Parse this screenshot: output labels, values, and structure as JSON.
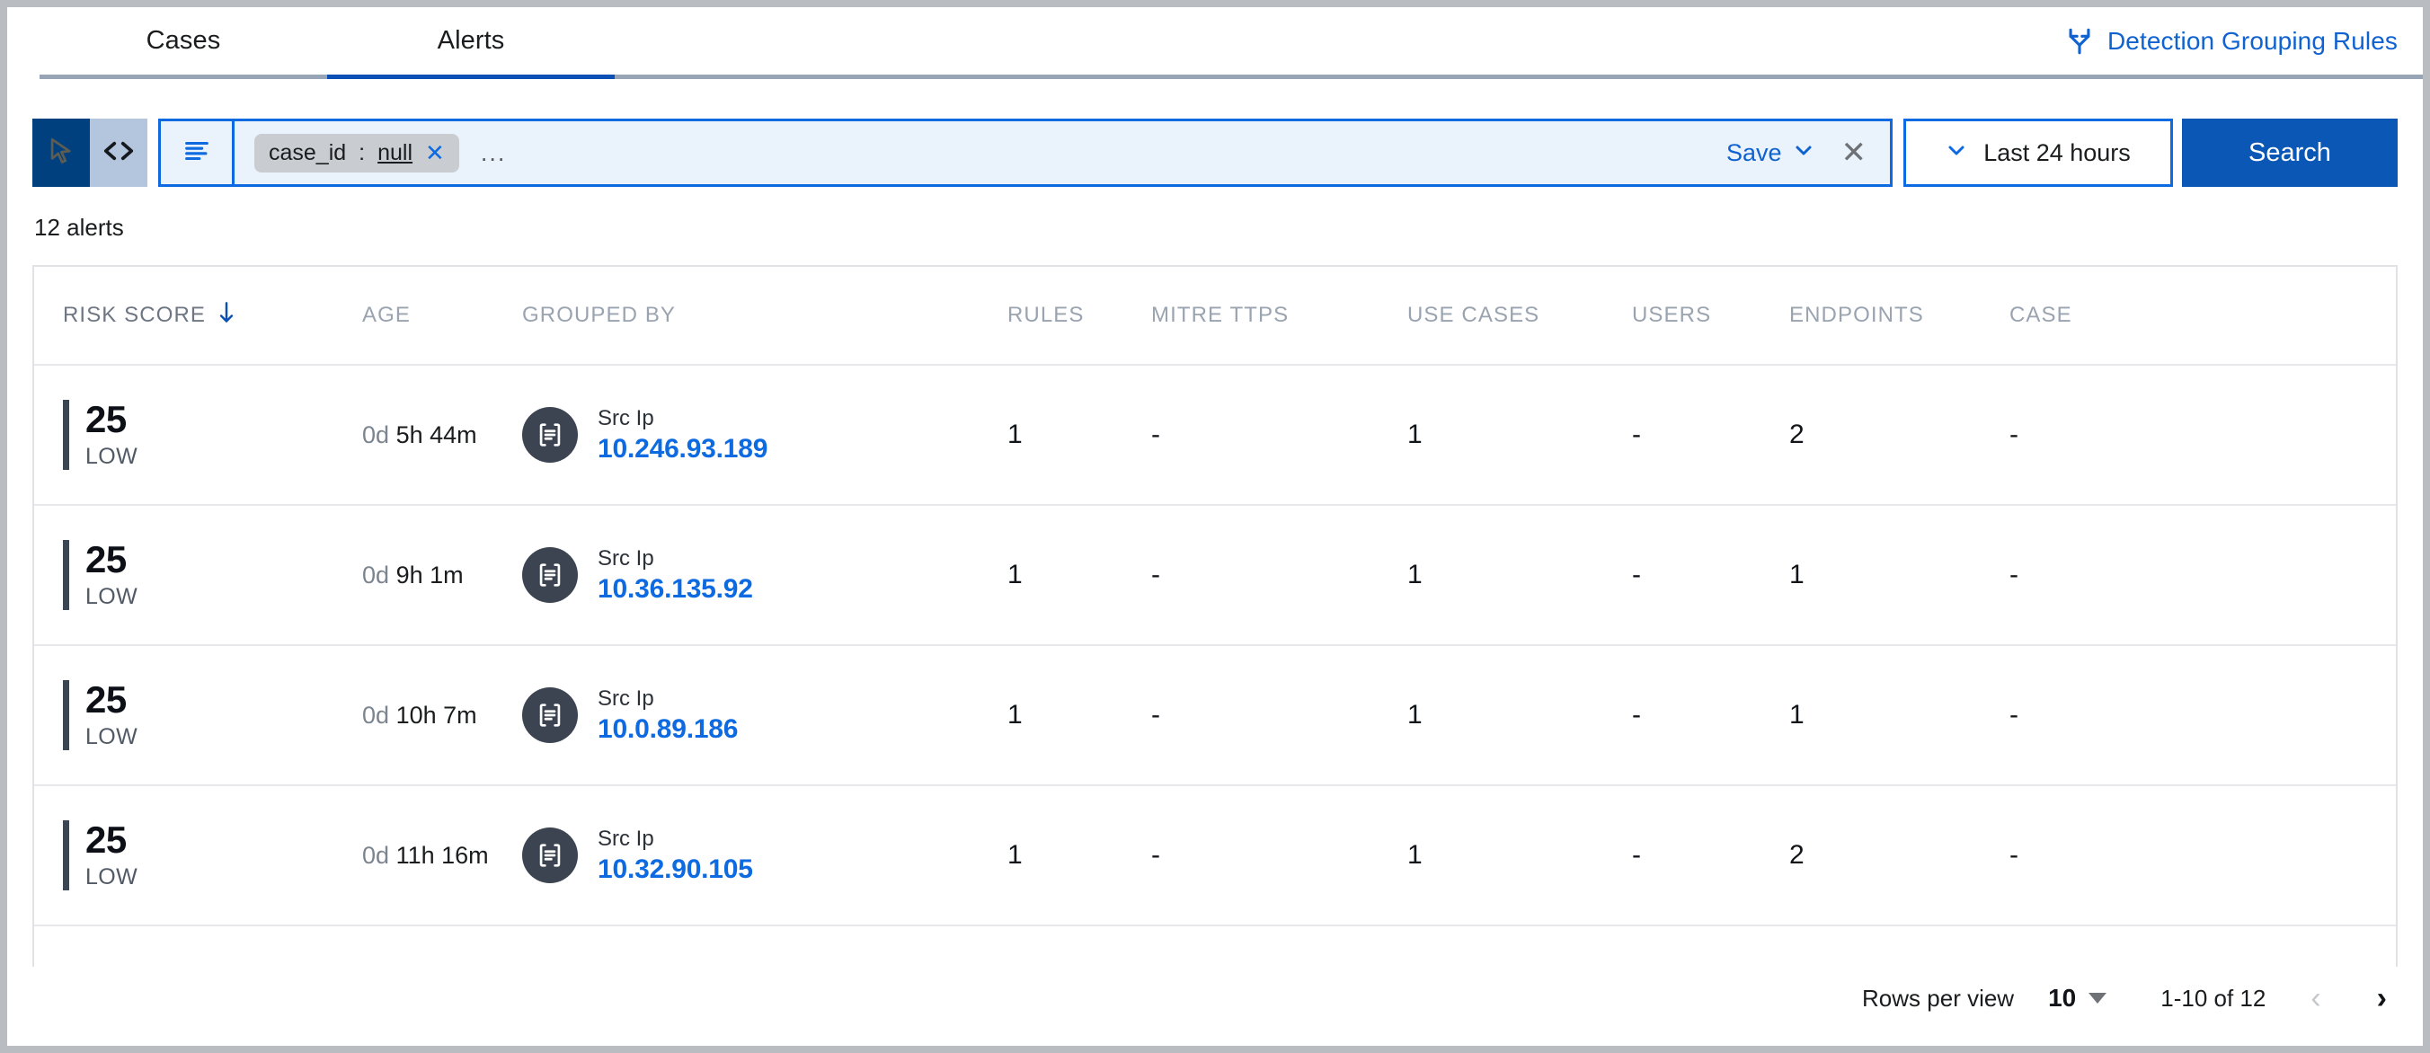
{
  "tabs": [
    {
      "label": "Cases",
      "active": false
    },
    {
      "label": "Alerts",
      "active": true
    }
  ],
  "header": {
    "detection_grouping_rules": "Detection Grouping Rules",
    "detection_grouping_rules_icon": "branch-fork-icon"
  },
  "search": {
    "mode_toggle": {
      "pointer_icon": "cursor-pointer-icon",
      "code_icon": "code-brackets-icon",
      "active": "pointer"
    },
    "filter_icon": "filter-list-icon",
    "filter_pill": {
      "field": "case_id",
      "separator": ":",
      "value": "null",
      "remove_icon": "close-x-icon"
    },
    "more_filters": "...",
    "save_label": "Save",
    "save_caret_icon": "chevron-down-icon",
    "clear_icon": "close-x-icon",
    "time_range": "Last 24 hours",
    "time_caret_icon": "chevron-down-icon",
    "search_button": "Search"
  },
  "results": {
    "count_label": "12 alerts",
    "columns": [
      {
        "key": "risk",
        "label": "RISK SCORE",
        "sorted": true,
        "sort_icon": "arrow-down-icon"
      },
      {
        "key": "age",
        "label": "AGE",
        "sorted": false
      },
      {
        "key": "group",
        "label": "GROUPED BY",
        "sorted": false
      },
      {
        "key": "rules",
        "label": "RULES",
        "sorted": false
      },
      {
        "key": "mitre",
        "label": "MITRE TTPS",
        "sorted": false
      },
      {
        "key": "usecase",
        "label": "USE CASES",
        "sorted": false
      },
      {
        "key": "users",
        "label": "USERS",
        "sorted": false
      },
      {
        "key": "end",
        "label": "ENDPOINTS",
        "sorted": false
      },
      {
        "key": "case",
        "label": "CASE",
        "sorted": false
      }
    ],
    "rows": [
      {
        "risk_score": "25",
        "risk_level": "LOW",
        "age_days": "0d",
        "age_time": "5h 44m",
        "group_icon": "field-value-icon",
        "group_field": "Src Ip",
        "group_value": "10.246.93.189",
        "rules": "1",
        "mitre_ttps": "-",
        "use_cases": "1",
        "users": "-",
        "endpoints": "2",
        "case": "-"
      },
      {
        "risk_score": "25",
        "risk_level": "LOW",
        "age_days": "0d",
        "age_time": "9h 1m",
        "group_icon": "field-value-icon",
        "group_field": "Src Ip",
        "group_value": "10.36.135.92",
        "rules": "1",
        "mitre_ttps": "-",
        "use_cases": "1",
        "users": "-",
        "endpoints": "1",
        "case": "-"
      },
      {
        "risk_score": "25",
        "risk_level": "LOW",
        "age_days": "0d",
        "age_time": "10h 7m",
        "group_icon": "field-value-icon",
        "group_field": "Src Ip",
        "group_value": "10.0.89.186",
        "rules": "1",
        "mitre_ttps": "-",
        "use_cases": "1",
        "users": "-",
        "endpoints": "1",
        "case": "-"
      },
      {
        "risk_score": "25",
        "risk_level": "LOW",
        "age_days": "0d",
        "age_time": "11h 16m",
        "group_icon": "field-value-icon",
        "group_field": "Src Ip",
        "group_value": "10.32.90.105",
        "rules": "1",
        "mitre_ttps": "-",
        "use_cases": "1",
        "users": "-",
        "endpoints": "2",
        "case": "-"
      }
    ]
  },
  "pagination": {
    "rows_per_view_label": "Rows per view",
    "rows_per_view_value": "10",
    "range_label": "1-10 of 12",
    "prev_icon": "chevron-left-icon",
    "next_icon": "chevron-right-icon",
    "prev_enabled": false,
    "next_enabled": true
  },
  "colors": {
    "accent_blue": "#0d6ae0",
    "button_blue": "#0b57b5",
    "toggle_active": "#00407f",
    "toggle_inactive": "#b3c6de",
    "risk_bar": "#3c4552",
    "group_icon_bg": "#3b4450",
    "header_text": "#9aa3b0"
  }
}
